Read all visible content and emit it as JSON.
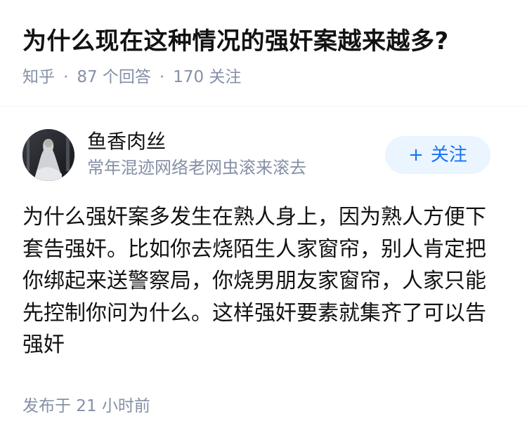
{
  "question": {
    "title": "为什么现在这种情况的强奸案越来越多?",
    "source": "知乎",
    "answers_count": "87 个回答",
    "followers_count": "170 关注",
    "separator": "·"
  },
  "author": {
    "name": "鱼香肉丝",
    "bio": "常年混迹网络老网虫滚来滚去",
    "avatar": "avatar-image"
  },
  "follow_button": {
    "icon": "+",
    "label": "关注"
  },
  "answer": {
    "content": "为什么强奸案多发生在熟人身上，因为熟人方便下套告强奸。比如你去烧陌生人家窗帘，别人肯定把你绑起来送警察局，你烧男朋友家窗帘，人家只能先控制你问为什么。这样强奸要素就集齐了可以告强奸",
    "published_time": "发布于 21 小时前"
  },
  "colors": {
    "meta_text": "#8590a6",
    "follow_bg": "#ebf5ff",
    "follow_text": "#1772f6",
    "divider": "#f0f2f5"
  }
}
